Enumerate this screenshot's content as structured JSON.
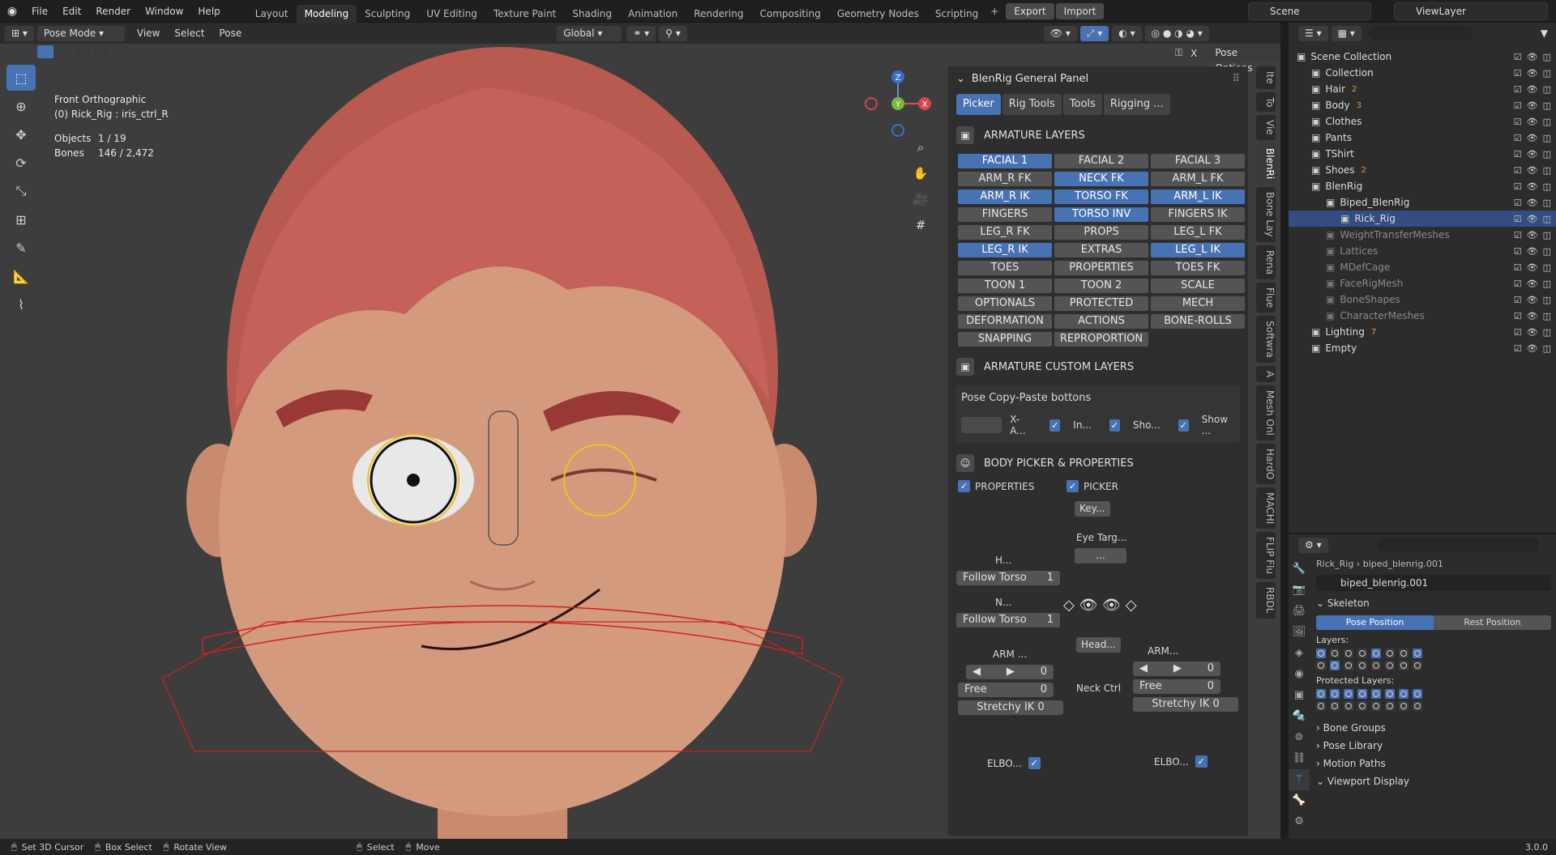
{
  "topbar": {
    "menus": [
      "File",
      "Edit",
      "Render",
      "Window",
      "Help"
    ],
    "workspaces": [
      "Layout",
      "Modeling",
      "Sculpting",
      "UV Editing",
      "Texture Paint",
      "Shading",
      "Animation",
      "Rendering",
      "Compositing",
      "Geometry Nodes",
      "Scripting"
    ],
    "active_workspace": "Modeling",
    "plus": "+",
    "export_label": "Export",
    "import_label": "Import",
    "scene_name": "Scene",
    "view_layer": "ViewLayer"
  },
  "viewport": {
    "mode": "Pose Mode",
    "menus": [
      "View",
      "Select",
      "Pose"
    ],
    "orientation": "Global",
    "pose_options": "Pose Options",
    "view_name": "Front Orthographic",
    "active_object": "(0) Rick_Rig : iris_ctrl_R",
    "objects_label": "Objects",
    "objects_value": "1 / 19",
    "bones_label": "Bones",
    "bones_value": "146 / 2,472",
    "gizmo": {
      "z": "Z",
      "y": "Y",
      "x": "X"
    }
  },
  "blenrig": {
    "panel_title": "BlenRig General Panel",
    "tabs": [
      {
        "label": "Picker",
        "active": true
      },
      {
        "label": "Rig Tools",
        "active": false
      },
      {
        "label": "Tools",
        "active": false
      },
      {
        "label": "Rigging ...",
        "active": false
      }
    ],
    "armature_layers_title": "ARMATURE LAYERS",
    "layers": [
      {
        "label": "FACIAL 1",
        "on": true
      },
      {
        "label": "FACIAL 2",
        "on": false
      },
      {
        "label": "FACIAL 3",
        "on": false
      },
      {
        "label": "ARM_R FK",
        "on": false
      },
      {
        "label": "NECK FK",
        "on": true
      },
      {
        "label": "ARM_L FK",
        "on": false
      },
      {
        "label": "ARM_R IK",
        "on": true
      },
      {
        "label": "TORSO FK",
        "on": true
      },
      {
        "label": "ARM_L IK",
        "on": true
      },
      {
        "label": "FINGERS",
        "on": false
      },
      {
        "label": "TORSO INV",
        "on": true
      },
      {
        "label": "FINGERS IK",
        "on": false
      },
      {
        "label": "LEG_R FK",
        "on": false
      },
      {
        "label": "PROPS",
        "on": false
      },
      {
        "label": "LEG_L FK",
        "on": false
      },
      {
        "label": "LEG_R IK",
        "on": true
      },
      {
        "label": "EXTRAS",
        "on": false
      },
      {
        "label": "LEG_L IK",
        "on": true
      },
      {
        "label": "TOES",
        "on": false
      },
      {
        "label": "PROPERTIES",
        "on": false
      },
      {
        "label": "TOES FK",
        "on": false
      },
      {
        "label": "TOON 1",
        "on": false
      },
      {
        "label": "TOON 2",
        "on": false
      },
      {
        "label": "SCALE",
        "on": false
      },
      {
        "label": "OPTIONALS",
        "on": false
      },
      {
        "label": "PROTECTED",
        "on": false
      },
      {
        "label": "MECH",
        "on": false
      },
      {
        "label": "DEFORMATION",
        "on": false
      },
      {
        "label": "ACTIONS",
        "on": false
      },
      {
        "label": "BONE-ROLLS",
        "on": false
      },
      {
        "label": "SNAPPING",
        "on": false
      },
      {
        "label": "REPROPORTION",
        "on": false
      }
    ],
    "custom_layers_title": "ARMATURE CUSTOM LAYERS",
    "copy_paste_title": "Pose Copy-Paste bottons",
    "copy_paste_items": [
      "X-A...",
      "In...",
      "Sho...",
      "Show ..."
    ],
    "body_picker_title": "BODY PICKER & PROPERTIES",
    "properties_label": "PROPERTIES",
    "picker_label": "PICKER",
    "key_label": "Key...",
    "eye_target_label": "Eye Targ...",
    "eye_target_btn": "...",
    "h_label": "H...",
    "n_label": "N...",
    "follow_torso_label": "Follow Torso",
    "follow_torso_value_1": "1",
    "follow_torso_value_2": "1",
    "head_label": "Head...",
    "neck_ctrl_label": "Neck Ctrl",
    "arm_left_label": "ARM ...",
    "arm_right_label": "ARM...",
    "arm_value": "0",
    "free_label": "Free",
    "free_value": "0",
    "stretchy_label": "Stretchy IK 0",
    "elbow_label": "ELBO..."
  },
  "sidetabs": [
    "Ite",
    "To",
    "Vie",
    "BlenRi",
    "Bone Lay",
    "Rena",
    "Flue",
    "Softwra",
    "A",
    "Mesh Onl",
    "HardO",
    "MACHI",
    "FLIP Flu",
    "RBDL"
  ],
  "outliner": {
    "rows": [
      {
        "label": "Scene Collection",
        "indent": 0,
        "state": "normal",
        "badge": ""
      },
      {
        "label": "Collection",
        "indent": 1,
        "state": "normal",
        "badge": ""
      },
      {
        "label": "Hair",
        "indent": 1,
        "state": "normal",
        "badge": "2"
      },
      {
        "label": "Body",
        "indent": 1,
        "state": "normal",
        "badge": "3"
      },
      {
        "label": "Clothes",
        "indent": 1,
        "state": "normal",
        "badge": ""
      },
      {
        "label": "Pants",
        "indent": 1,
        "state": "normal",
        "badge": ""
      },
      {
        "label": "TShirt",
        "indent": 1,
        "state": "normal",
        "badge": ""
      },
      {
        "label": "Shoes",
        "indent": 1,
        "state": "normal",
        "badge": "2"
      },
      {
        "label": "BlenRig",
        "indent": 1,
        "state": "normal",
        "badge": ""
      },
      {
        "label": "Biped_BlenRig",
        "indent": 2,
        "state": "normal",
        "badge": ""
      },
      {
        "label": "Rick_Rig",
        "indent": 3,
        "state": "sel",
        "badge": ""
      },
      {
        "label": "WeightTransferMeshes",
        "indent": 2,
        "state": "dim",
        "badge": ""
      },
      {
        "label": "Lattices",
        "indent": 2,
        "state": "dim",
        "badge": ""
      },
      {
        "label": "MDefCage",
        "indent": 2,
        "state": "dim",
        "badge": ""
      },
      {
        "label": "FaceRigMesh",
        "indent": 2,
        "state": "dim",
        "badge": ""
      },
      {
        "label": "BoneShapes",
        "indent": 2,
        "state": "dim",
        "badge": ""
      },
      {
        "label": "CharacterMeshes",
        "indent": 2,
        "state": "dim",
        "badge": ""
      },
      {
        "label": "Lighting",
        "indent": 1,
        "state": "normal",
        "badge": "7"
      },
      {
        "label": "Empty",
        "indent": 1,
        "state": "normal",
        "badge": ""
      }
    ]
  },
  "properties": {
    "breadcrumb_1": "Rick_Rig",
    "breadcrumb_2": "biped_blenrig.001",
    "data_name": "biped_blenrig.001",
    "skeleton_title": "Skeleton",
    "pose_position": "Pose Position",
    "rest_position": "Rest Position",
    "layers_label": "Layers:",
    "protected_label": "Protected Layers:",
    "layers_on": [
      1,
      0,
      0,
      0,
      1,
      0,
      0,
      1,
      0,
      1,
      0,
      0,
      0,
      0,
      0,
      0
    ],
    "protected_on": [
      1,
      1,
      1,
      1,
      1,
      1,
      1,
      1,
      0,
      0,
      0,
      0,
      0,
      0,
      0,
      0
    ],
    "collapsed": [
      "Bone Groups",
      "Pose Library",
      "Motion Paths"
    ],
    "viewport_display": "Viewport Display"
  },
  "statusbar": {
    "items": [
      "Set 3D Cursor",
      "Box Select",
      "Rotate View",
      "Select",
      "Move"
    ],
    "version": "3.0.0"
  }
}
